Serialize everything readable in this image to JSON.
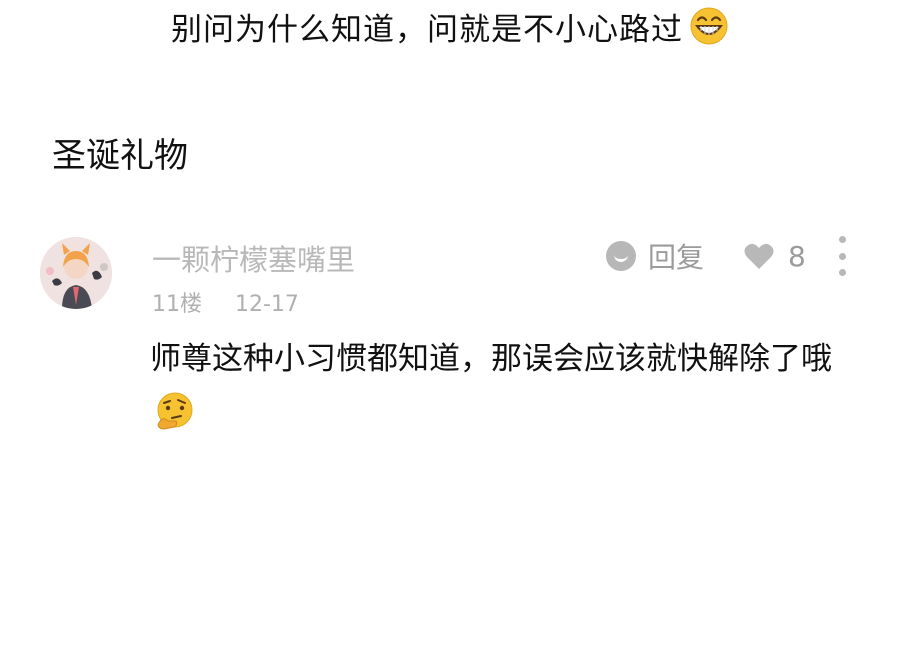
{
  "top_text": "别问为什么知道，问就是不小心路过",
  "top_emoji": "grinning-face",
  "section_title": "圣诞礼物",
  "comment": {
    "username": "一颗柠檬塞嘴里",
    "floor": "11楼",
    "date": "12-17",
    "reply_label": "回复",
    "like_count": "8",
    "body": "师尊这种小习惯都知道，那误会应该就快解除了哦",
    "body_emoji": "thinking-face"
  },
  "colors": {
    "text": "#111111",
    "muted": "#b8b8b8",
    "action": "#9b9b9b",
    "emoji_yellow": "#f7c232"
  }
}
